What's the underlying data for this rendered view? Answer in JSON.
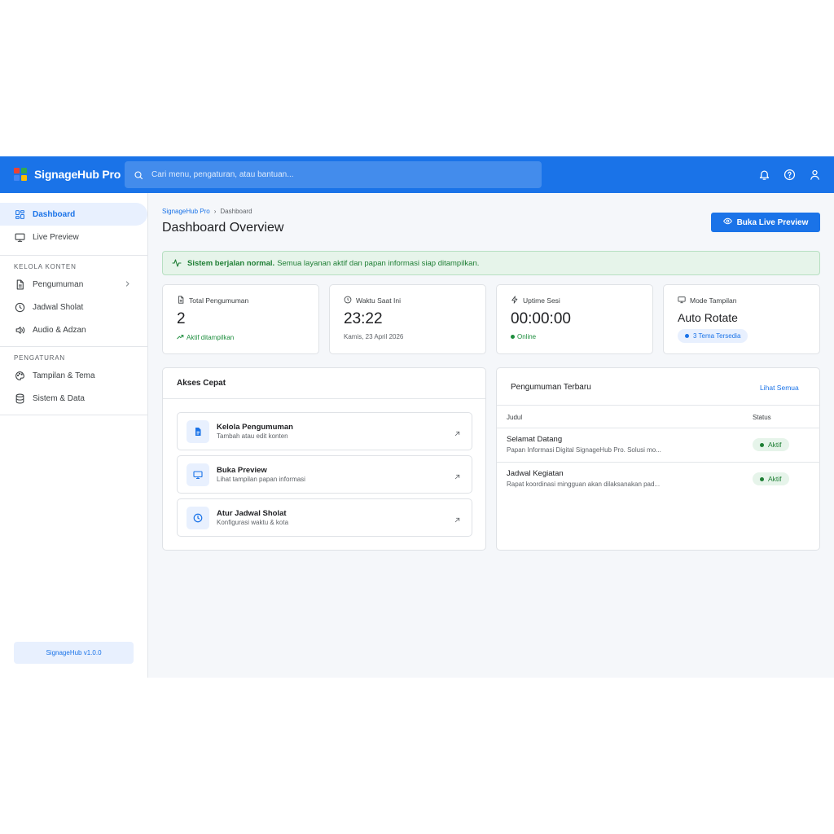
{
  "colors": {
    "primary": "#1a73e8",
    "success": "#1e8e3e",
    "surface": "#f5f7fa"
  },
  "topbar": {
    "brand": "SignageHub Pro",
    "search_placeholder": "Cari menu, pengaturan, atau bantuan...",
    "icons": [
      "bell-icon",
      "help-icon",
      "user-icon"
    ]
  },
  "sidebar": {
    "items": [
      {
        "label": "Dashboard",
        "icon": "grid-icon",
        "active": true
      },
      {
        "label": "Live Preview",
        "icon": "monitor-icon"
      }
    ],
    "sections": [
      {
        "title": "KELOLA KONTEN",
        "items": [
          {
            "label": "Pengumuman",
            "icon": "document-icon"
          },
          {
            "label": "Jadwal Sholat",
            "icon": "clock-icon"
          },
          {
            "label": "Audio & Adzan",
            "icon": "speaker-icon"
          }
        ]
      },
      {
        "title": "PENGATURAN",
        "items": [
          {
            "label": "Tampilan & Tema",
            "icon": "palette-icon"
          },
          {
            "label": "Sistem & Data",
            "icon": "database-icon"
          }
        ]
      }
    ],
    "version": "SignageHub v1.0.0"
  },
  "header": {
    "breadcrumb_root": "SignageHub Pro",
    "breadcrumb_sep": "›",
    "breadcrumb_current": "Dashboard",
    "title": "Dashboard Overview",
    "preview_button": "Buka Live Preview"
  },
  "alert": {
    "strong": "Sistem berjalan normal.",
    "text": "Semua layanan aktif dan papan informasi siap ditampilkan."
  },
  "stats": [
    {
      "label": "Total Pengumuman",
      "value": "2",
      "sub": "Aktif ditampilkan",
      "icon": "document-icon"
    },
    {
      "label": "Waktu Saat Ini",
      "value": "23:22",
      "sub": "Kamis, 23 April 2026",
      "icon": "clock-icon"
    },
    {
      "label": "Uptime Sesi",
      "value": "00:00:00",
      "sub": "Online",
      "icon": "bolt-icon"
    },
    {
      "label": "Mode Tampilan",
      "value": "Auto Rotate",
      "sub": "3 Tema Tersedia",
      "icon": "monitor-icon"
    }
  ],
  "quick_access": {
    "title": "Akses Cepat",
    "items": [
      {
        "title": "Kelola Pengumuman",
        "subtitle": "Tambah atau edit konten",
        "icon": "document-icon"
      },
      {
        "title": "Buka Preview",
        "subtitle": "Lihat tampilan papan informasi",
        "icon": "monitor-icon"
      },
      {
        "title": "Atur Jadwal Sholat",
        "subtitle": "Konfigurasi waktu & kota",
        "icon": "clock-icon"
      }
    ]
  },
  "announcements": {
    "title": "Pengumuman Terbaru",
    "see_all": "Lihat Semua",
    "columns": [
      "Judul",
      "Status"
    ],
    "rows": [
      {
        "title": "Selamat Datang",
        "desc": "Papan Informasi Digital SignageHub Pro. Solusi mo...",
        "status": "Aktif"
      },
      {
        "title": "Jadwal Kegiatan",
        "desc": "Rapat koordinasi mingguan akan dilaksanakan pad...",
        "status": "Aktif"
      }
    ]
  }
}
